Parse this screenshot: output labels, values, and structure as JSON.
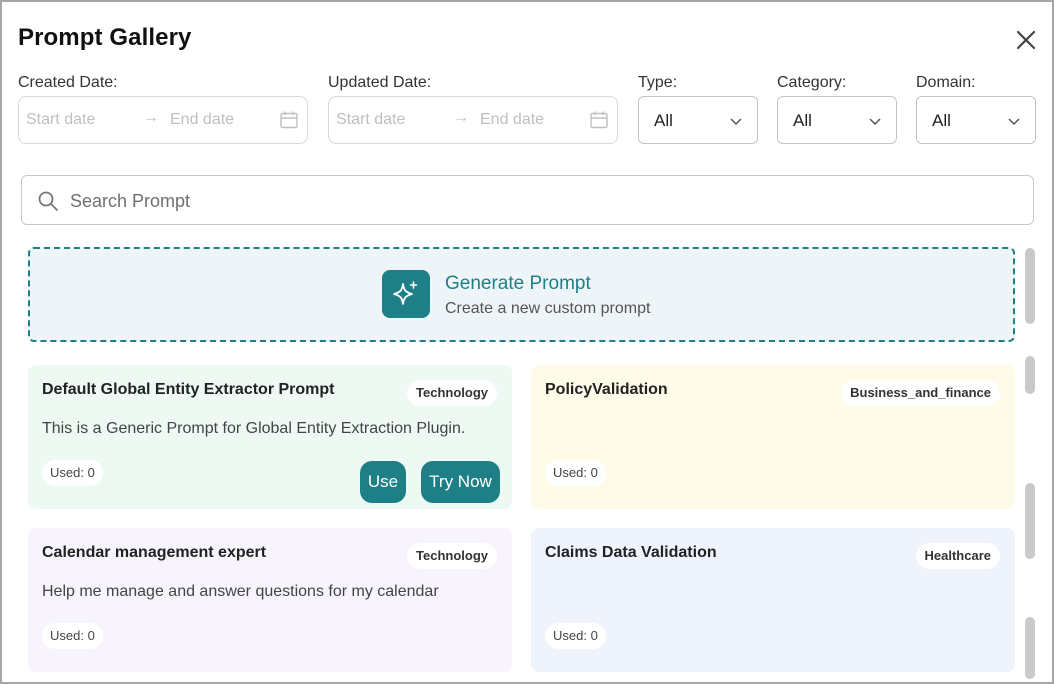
{
  "dialog": {
    "title": "Prompt Gallery"
  },
  "filters": {
    "created_label": "Created Date:",
    "updated_label": "Updated Date:",
    "start_placeholder": "Start date",
    "end_placeholder": "End date",
    "arrow": "→",
    "type_label": "Type:",
    "type_value": "All",
    "category_label": "Category:",
    "category_value": "All",
    "domain_label": "Domain:",
    "domain_value": "All"
  },
  "search": {
    "placeholder": "Search Prompt"
  },
  "generate": {
    "title": "Generate Prompt",
    "subtitle": "Create a new custom prompt",
    "icon": "sparkle-icon"
  },
  "cards": [
    {
      "title": "Default Global Entity Extractor Prompt",
      "badge": "Technology",
      "description": "This is a Generic Prompt for Global Entity Extraction Plugin.",
      "used": "Used: 0",
      "use_label": "Use",
      "try_label": "Try Now",
      "color": "#edf9f2"
    },
    {
      "title": "PolicyValidation",
      "badge": "Business_and_finance",
      "description": "",
      "used": "Used: 0",
      "color": "#fefbe9"
    },
    {
      "title": "Calendar management expert",
      "badge": "Technology",
      "description": "Help me manage and answer questions for my calendar",
      "used": "Used: 0",
      "color": "#f8f4fd"
    },
    {
      "title": "Claims Data Validation",
      "badge": "Healthcare",
      "description": "",
      "used": "Used: 0",
      "color": "#eef3fc"
    }
  ],
  "colors": {
    "accent": "#1e7f86",
    "border": "#a6a6a6"
  }
}
